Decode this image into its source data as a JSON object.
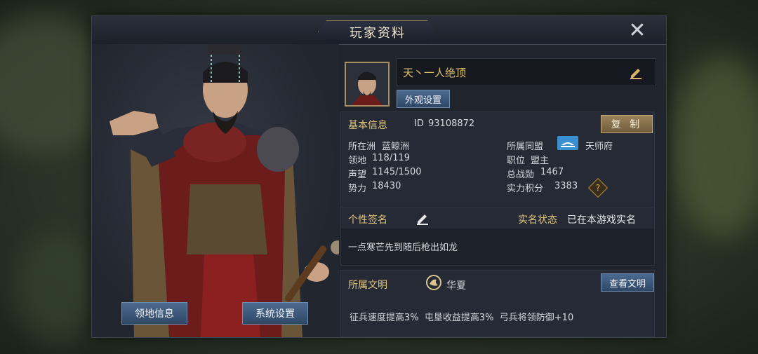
{
  "panel": {
    "title": "玩家资料",
    "close_glyph": "✕"
  },
  "player": {
    "name": "天丶一人绝顶",
    "appearance_button": "外观设置"
  },
  "basic_info": {
    "heading": "基本信息",
    "id_label": "ID",
    "id_value": "93108872",
    "copy_button": "复 制",
    "location_label": "所在洲",
    "location_value": "蓝鲸洲",
    "territory_label": "领地",
    "territory_value": "118/119",
    "reputation_label": "声望",
    "reputation_value": "1145/1500",
    "power_label": "势力",
    "power_value": "18430",
    "alliance_label": "所属同盟",
    "alliance_value": "天师府",
    "position_label": "职位",
    "position_value": "盟主",
    "merit_label": "总战勋",
    "merit_value": "1467",
    "strength_label": "实力积分",
    "strength_value": "3383",
    "help_glyph": "?"
  },
  "signature": {
    "heading": "个性签名",
    "text": "一点寒芒先到随后枪出如龙",
    "realname_label": "实名状态",
    "realname_value": "已在本游戏实名"
  },
  "civilization": {
    "heading": "所属文明",
    "value": "华夏",
    "view_button": "查看文明",
    "bonus": "征兵速度提高3%  屯垦收益提高3%  弓兵将领防御+10"
  },
  "bottom_buttons": {
    "territory_info": "领地信息",
    "system_settings": "系统设置"
  },
  "colors": {
    "gold": "#e2c77e",
    "name_gold": "#e4c26a",
    "panel": "#1f242d",
    "button_blue": "#3d5a7d"
  }
}
